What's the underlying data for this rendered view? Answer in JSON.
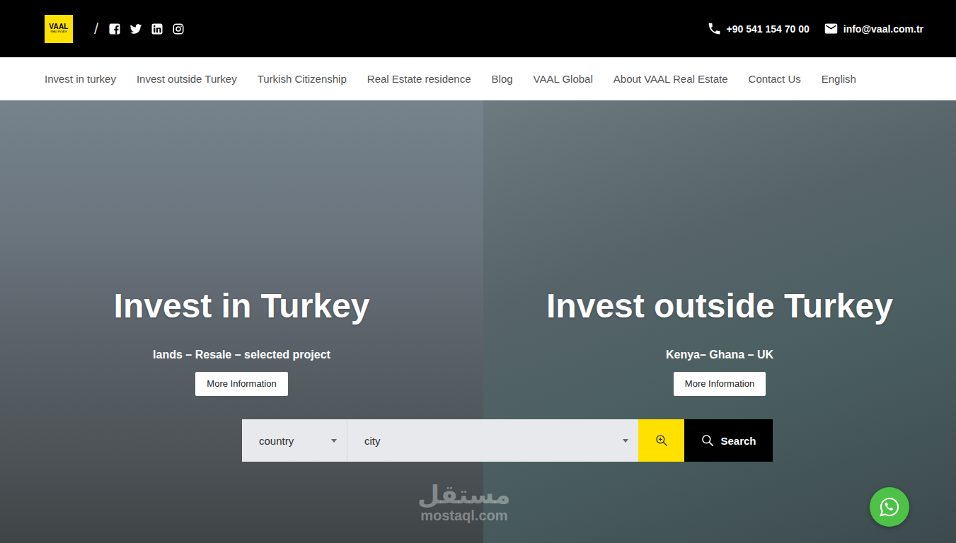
{
  "header": {
    "logo": {
      "name": "VAAL",
      "tagline": "REAL ESTATE"
    },
    "separator": "/",
    "phone": "+90 541 154 70 00",
    "email": "info@vaal.com.tr"
  },
  "nav": [
    "Invest in turkey",
    "Invest outside Turkey",
    "Turkish Citizenship",
    "Real Estate residence",
    "Blog",
    "VAAL Global",
    "About VAAL Real Estate",
    "Contact Us",
    "English"
  ],
  "hero": {
    "panels": [
      {
        "title": "Invest in Turkey",
        "subtitle": "lands – Resale –  selected project",
        "button": "More Information"
      },
      {
        "title": "Invest outside Turkey",
        "subtitle": "Kenya– Ghana – UK",
        "button": "More Information"
      }
    ],
    "search": {
      "country": "country",
      "city": "city",
      "button": "Search"
    }
  },
  "watermark": {
    "arabic": "مستقل",
    "latin": "mostaql.com"
  }
}
